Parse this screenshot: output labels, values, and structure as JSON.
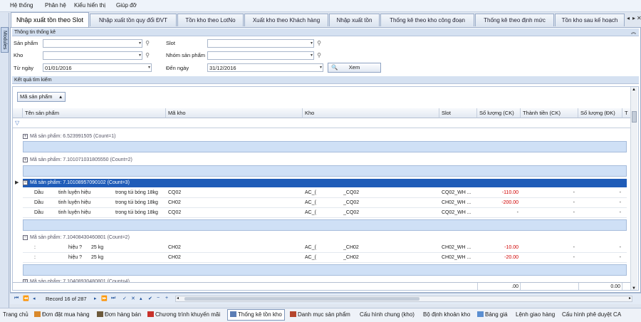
{
  "menu": [
    "Hệ thống",
    "Phân hệ",
    "Kiểu hiển thị",
    "Giúp đỡ"
  ],
  "modules_label": "Modules",
  "tabs": [
    "Nhập xuất tồn theo Slot",
    "Nhập xuất tồn quy đổi ĐVT",
    "Tồn kho theo LotNo",
    "Xuất kho theo Khách hàng",
    "Nhập xuất tồn",
    "Thống kê theo kho công đoạn",
    "Thống kê theo định mức",
    "Tồn kho sau kế hoạch"
  ],
  "filter": {
    "title": "Thông tin thống kê",
    "san_pham_label": "Sản phẩm",
    "kho_label": "Kho",
    "tu_ngay_label": "Từ ngày",
    "tu_ngay_value": "01/01/2016",
    "slot_label": "Slot",
    "nhom_sp_label": "Nhóm sản phẩm",
    "den_ngay_label": "Đến ngày",
    "den_ngay_value": "31/12/2016",
    "xem_label": "Xem"
  },
  "results": {
    "title": "Kết quả tìm kiếm",
    "group_chip": "Mã sản phẩm",
    "columns": [
      "Tên sản phẩm",
      "Mã kho",
      "Kho",
      "Slot",
      "Số lượng (CK)",
      "Thành tiền (CK)",
      "Số lượng (ĐK)",
      "T"
    ],
    "groups": [
      {
        "label": "Mã sản phẩm: 6.523991505 (Count=1)"
      },
      {
        "label": "Mã sản phẩm: 7.101071031805550 (Count=2)"
      },
      {
        "label": "Mã sản phẩm: 7.10108957090102 (Count=3)"
      },
      {
        "label": "Mã sản phẩm: 7.10408430460801 (Count=2)"
      },
      {
        "label": "Mã sản phẩm: 7.10408930480801 (Count=4)"
      }
    ],
    "rows_g3": [
      {
        "name_a": "Dầu",
        "name_b": "tinh luyện hiệu",
        "name_c": "trong túi bóng 18kg",
        "ma_kho": "CQ02",
        "kho_a": "AC_(",
        "kho_b": "_CQ02",
        "slot": "CQ02_WH ...",
        "sl_ck": "-110.00",
        "tt_ck": "-",
        "sl_dk": "-"
      },
      {
        "name_a": "Dầu",
        "name_b": "tinh luyện hiệu",
        "name_c": "trong túi bóng 18kg",
        "ma_kho": "CH02",
        "kho_a": "AC_(",
        "kho_b": "_CQ02",
        "slot": "CH02_WH ...",
        "sl_ck": "-200.00",
        "tt_ck": "-",
        "sl_dk": "-"
      },
      {
        "name_a": "Dầu",
        "name_b": "tinh luyện hiệu",
        "name_c": "trong túi bóng 18kg",
        "ma_kho": "CQ02",
        "kho_a": "AC_(",
        "kho_b": "_CQ02",
        "slot": "CQ02_WH ...",
        "sl_ck": "-",
        "tt_ck": "-",
        "sl_dk": "-"
      }
    ],
    "rows_g4": [
      {
        "name_a": ":",
        "name_b": "hiệu ?",
        "name_c": "25 kg",
        "ma_kho": "CH02",
        "kho_a": "AC_(",
        "kho_b": "_CH02",
        "slot": "CH02_WH ...",
        "sl_ck": "-10.00",
        "tt_ck": "-",
        "sl_dk": "-"
      },
      {
        "name_a": ":",
        "name_b": "hiệu ?",
        "name_c": "25 kg",
        "ma_kho": "CH02",
        "kho_a": "AC_(",
        "kho_b": "_CH02",
        "slot": "CH02_WH ...",
        "sl_ck": "-20.00",
        "tt_ck": "-",
        "sl_dk": "-"
      }
    ],
    "footer_sl_ck": ".00",
    "footer_sl_dk": "0.00"
  },
  "navigator": {
    "record_text": "Record 16 of 287"
  },
  "bottom_bar": [
    "Trang chủ",
    "Đơn đặt mua hàng",
    "Đơn hàng bán",
    "Chương trình khuyến mãi",
    "Thống kê tồn kho",
    "Danh mục sản phẩm",
    "Cấu hình chung (kho)",
    "Bộ định khoản kho",
    "Bảng giá",
    "Lệnh giao hàng",
    "Cấu hình phê duyệt CA"
  ],
  "colors": {
    "selected_row": "#1f5cb8",
    "negative": "#d00000",
    "group_header": "#d5e1f1"
  }
}
